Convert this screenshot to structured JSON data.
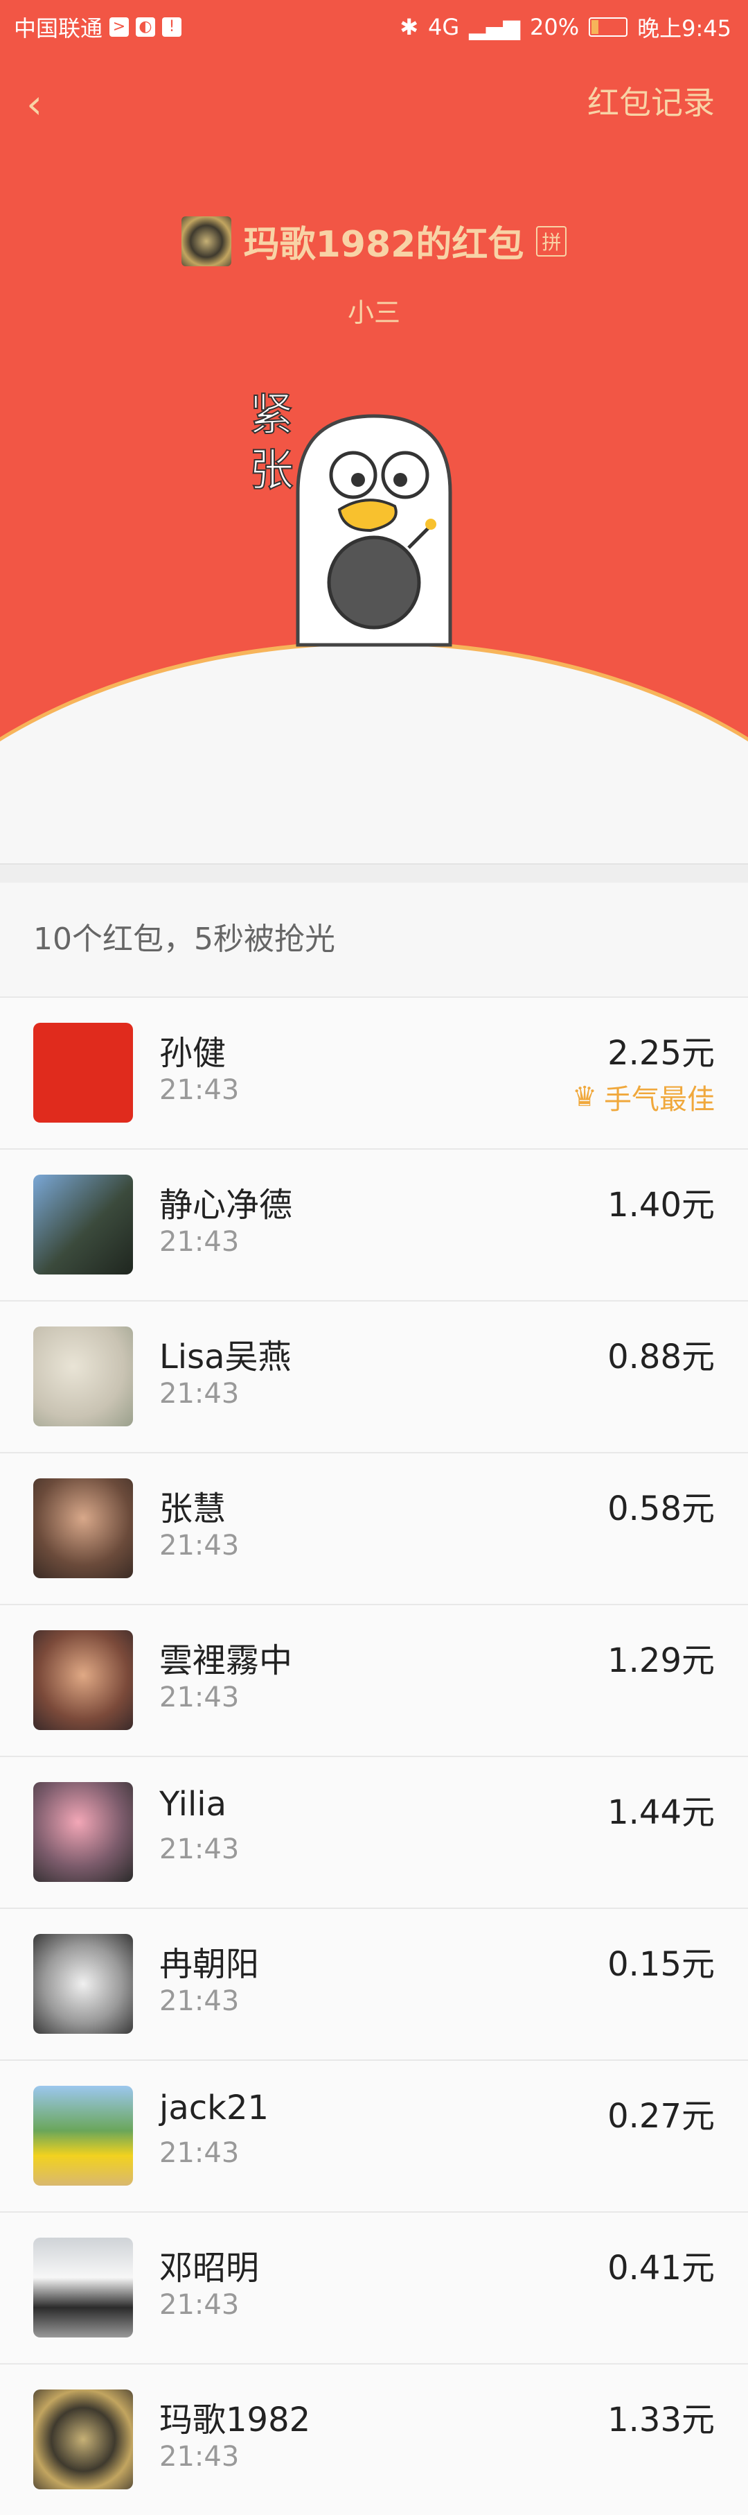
{
  "status_bar": {
    "carrier": "中国联通",
    "network": "4G",
    "battery": "20%",
    "time": "晚上9:45"
  },
  "nav": {
    "back_label": "‹",
    "records_label": "红包记录"
  },
  "header": {
    "title": "玛歌1982的红包",
    "pin_badge": "拼",
    "subtitle": "小三",
    "sticker_text": "紧张"
  },
  "summary": "10个红包，5秒被抢光",
  "best_label": "手气最佳",
  "entries": [
    {
      "name": "孙健",
      "time": "21:43",
      "amount": "2.25元",
      "best": true
    },
    {
      "name": "静心净德",
      "time": "21:43",
      "amount": "1.40元"
    },
    {
      "name": "Lisa吴燕",
      "time": "21:43",
      "amount": "0.88元"
    },
    {
      "name": "张慧",
      "time": "21:43",
      "amount": "0.58元"
    },
    {
      "name": "雲裡霧中",
      "time": "21:43",
      "amount": "1.29元"
    },
    {
      "name": "Yilia",
      "time": "21:43",
      "amount": "1.44元"
    },
    {
      "name": "冉朝阳",
      "time": "21:43",
      "amount": "0.15元"
    },
    {
      "name": "jack21",
      "time": "21:43",
      "amount": "0.27元"
    },
    {
      "name": "邓昭明",
      "time": "21:43",
      "amount": "0.41元"
    },
    {
      "name": "玛歌1982",
      "time": "21:43",
      "amount": "1.33元"
    }
  ],
  "colors": {
    "header_red": "#f25645",
    "gold": "#f8d3a6",
    "best_orange": "#f0a83c"
  }
}
